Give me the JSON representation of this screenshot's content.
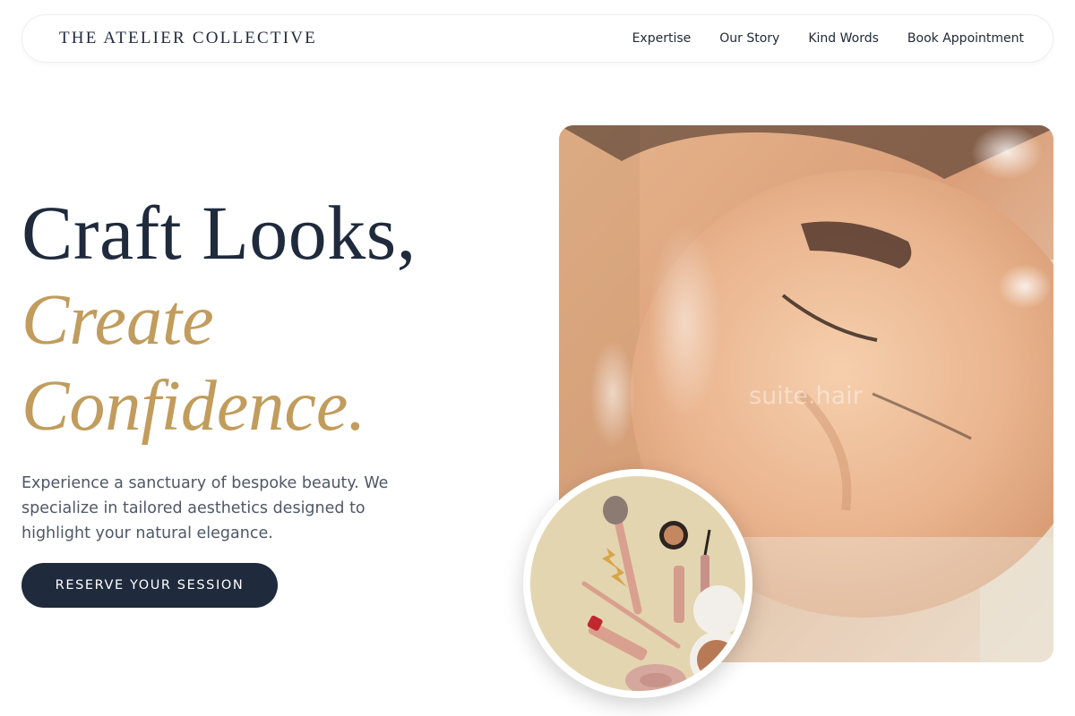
{
  "nav": {
    "brand": "THE ATELIER COLLECTIVE",
    "links": [
      "Expertise",
      "Our Story",
      "Kind Words",
      "Book Appointment"
    ]
  },
  "hero": {
    "title_line1": "Craft Looks,",
    "title_line2": "Create",
    "title_line3": "Confidence.",
    "description": "Experience a sanctuary of bespoke beauty. We specialize in tailored aesthetics designed to highlight your natural elegance.",
    "cta_label": "RESERVE YOUR SESSION"
  },
  "media": {
    "watermark": "suite.hair",
    "main_image": "closed-eyes-portrait-photo",
    "circle_image": "makeup-products-flatlay-photo"
  },
  "colors": {
    "navy": "#1f2a3c",
    "gold": "#c19c5c",
    "body_text": "#4e5766",
    "background": "#ffffff"
  }
}
